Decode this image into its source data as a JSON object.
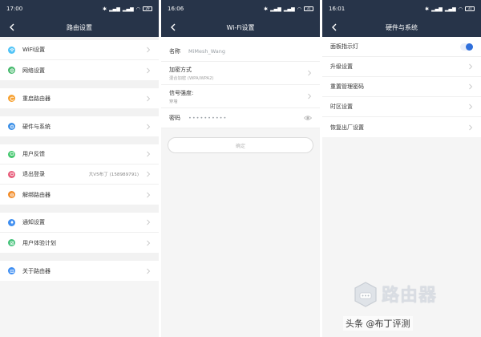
{
  "screens": [
    {
      "status": {
        "time": "17:00",
        "battery": "29"
      },
      "title": "路由设置",
      "groups": [
        [
          {
            "label": "WiFi设置",
            "icon": "wifi-icon",
            "color": "#4fc3f7"
          },
          {
            "label": "网络设置",
            "icon": "globe-icon",
            "color": "#43b86a"
          }
        ],
        [
          {
            "label": "重启路由器",
            "icon": "restart-icon",
            "color": "#f7a233"
          }
        ],
        [
          {
            "label": "硬件与系统",
            "icon": "gear-icon",
            "color": "#3b8fe7"
          }
        ],
        [
          {
            "label": "用户反馈",
            "icon": "feedback-icon",
            "color": "#43c76d"
          },
          {
            "label": "退出登录",
            "icon": "logout-icon",
            "color": "#e85d7b",
            "value": "大V5布丁 (158989791)"
          },
          {
            "label": "解绑路由器",
            "icon": "unbind-icon",
            "color": "#f28c28"
          }
        ],
        [
          {
            "label": "通知设置",
            "icon": "bell-icon",
            "color": "#3f8ef0"
          },
          {
            "label": "用户体验计划",
            "icon": "plan-icon",
            "color": "#45c27a"
          }
        ],
        [
          {
            "label": "关于路由器",
            "icon": "info-icon",
            "color": "#3e8ef2"
          }
        ]
      ]
    },
    {
      "status": {
        "time": "16:06",
        "battery": "31"
      },
      "title": "Wi-Fi设置",
      "fields": {
        "name_label": "名称",
        "name_value": "MiMesh_Wang",
        "enc_label": "加密方式",
        "enc_value": "混合加密 (WPA/WPA2)",
        "signal_label": "信号强度:",
        "signal_value": "穿墙",
        "pwd_label": "密码",
        "pwd_value": "••••••••••",
        "confirm": "确定"
      }
    },
    {
      "status": {
        "time": "16:01",
        "battery": "31"
      },
      "title": "硬件与系统",
      "items": [
        {
          "label": "面板指示灯",
          "toggle": true
        },
        {
          "label": "升级设置"
        },
        {
          "label": "重置管理密码"
        },
        {
          "label": "时区设置"
        },
        {
          "label": "恢复出厂设置"
        }
      ]
    }
  ],
  "watermark": {
    "big": "路由器",
    "small": "头条 @布丁评测"
  },
  "colors": {
    "nav": "#273449",
    "accent": "#2f6fdb"
  }
}
